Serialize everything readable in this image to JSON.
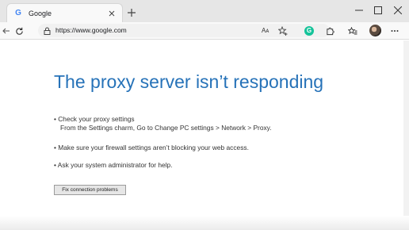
{
  "tab": {
    "favicon_letter": "G",
    "title": "Google"
  },
  "toolbar": {
    "url": "https://www.google.com",
    "read_aloud": "Aᴀ"
  },
  "extensions": {
    "grammarly_letter": "G"
  },
  "error": {
    "heading": "The proxy server isn’t responding",
    "bullets": [
      "•  Check your proxy settings",
      "From the Settings charm, Go to Change PC settings > Network > Proxy.",
      "•  Make sure your firewall settings aren’t blocking your web access.",
      "•  Ask your system administrator for help."
    ],
    "fix_button": "Fix connection problems"
  },
  "colors": {
    "heading": "#2672b8",
    "tabstrip": "#e6e6e6",
    "toolbar": "#f9f9f9",
    "grammarly": "#15c39a"
  }
}
